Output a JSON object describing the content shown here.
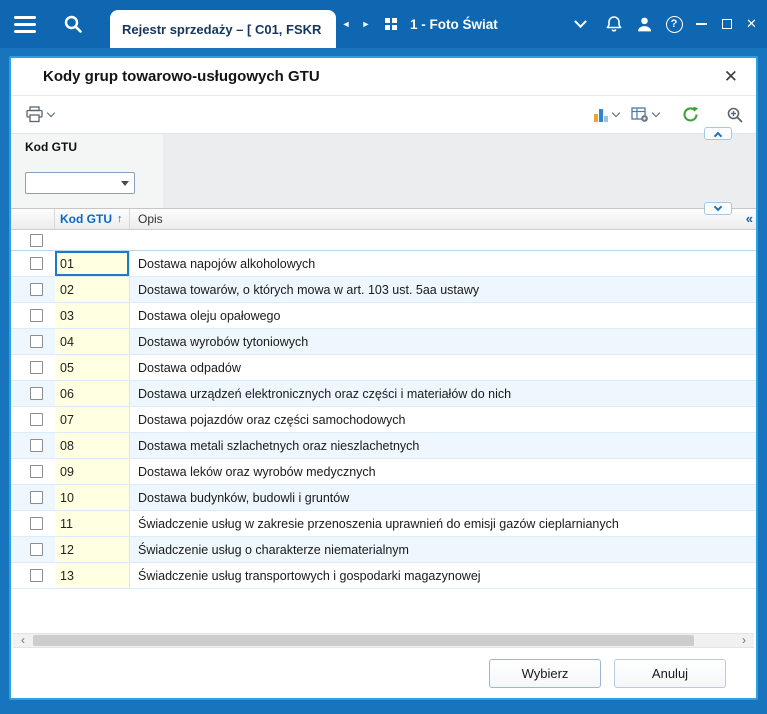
{
  "titlebar": {
    "tab": "Rejestr sprzedaży – [ C01, FSKR",
    "company": "1 - Foto Świat"
  },
  "dialog": {
    "title": "Kody grup towarowo-usługowych GTU",
    "filter_label": "Kod GTU",
    "filter_value": "",
    "columns": {
      "kod": "Kod GTU",
      "opis": "Opis"
    },
    "rows": [
      {
        "kod": "01",
        "opis": "Dostawa napojów alkoholowych"
      },
      {
        "kod": "02",
        "opis": "Dostawa towarów, o których mowa w art. 103 ust. 5aa ustawy"
      },
      {
        "kod": "03",
        "opis": "Dostawa oleju opałowego"
      },
      {
        "kod": "04",
        "opis": "Dostawa wyrobów tytoniowych"
      },
      {
        "kod": "05",
        "opis": "Dostawa odpadów"
      },
      {
        "kod": "06",
        "opis": "Dostawa urządzeń elektronicznych oraz części i materiałów do nich"
      },
      {
        "kod": "07",
        "opis": "Dostawa pojazdów oraz części samochodowych"
      },
      {
        "kod": "08",
        "opis": "Dostawa metali szlachetnych oraz nieszlachetnych"
      },
      {
        "kod": "09",
        "opis": "Dostawa leków oraz wyrobów medycznych"
      },
      {
        "kod": "10",
        "opis": "Dostawa budynków, budowli i gruntów"
      },
      {
        "kod": "11",
        "opis": "Świadczenie usług w zakresie przenoszenia uprawnień do emisji gazów cieplarnianych"
      },
      {
        "kod": "12",
        "opis": "Świadczenie usług o charakterze niematerialnym"
      },
      {
        "kod": "13",
        "opis": "Świadczenie usług transportowych i gospodarki magazynowej"
      }
    ],
    "buttons": {
      "select": "Wybierz",
      "cancel": "Anuluj"
    }
  },
  "glyphs": {
    "close": "✕",
    "sort_up": "↑",
    "collapse_left": "«",
    "scroll_left": "‹",
    "scroll_right": "›",
    "nav_left": "◄",
    "nav_right": "►",
    "help": "?"
  },
  "colors": {
    "titlebar": "#0f67b1",
    "frame": "#1875bd",
    "dialog_border": "#2da2e0",
    "column_link": "#0a6ac2",
    "kod_cell_bg": "#ffffe1",
    "row_alt_bg": "#eef7fd",
    "focus_border": "#1e7ac1",
    "refresh_green": "#3aa33a"
  }
}
